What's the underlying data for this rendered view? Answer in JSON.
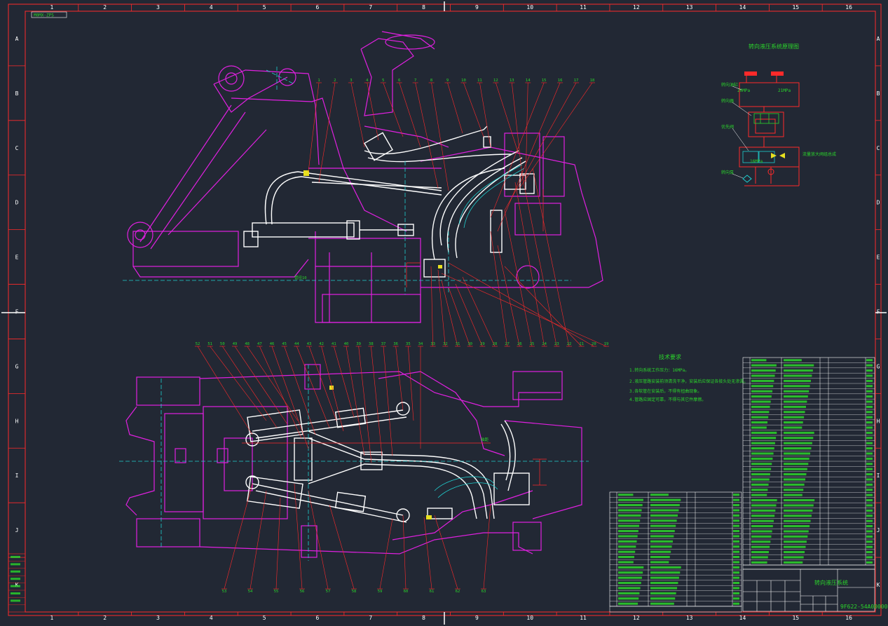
{
  "sheet": {
    "top_tag": "M0MX-ZPS",
    "col_labels": [
      "1",
      "2",
      "3",
      "4",
      "5",
      "6",
      "7",
      "8",
      "9",
      "10",
      "11",
      "12",
      "13",
      "14",
      "15",
      "16"
    ],
    "row_labels": [
      "A",
      "B",
      "C",
      "D",
      "E",
      "F",
      "G",
      "H",
      "I",
      "J",
      "K"
    ],
    "drawing_number": "9F622-54A00000",
    "title_block_name": "转向液压系统"
  },
  "schematic": {
    "title": "转向液压系统原理图",
    "labels": [
      "转向油缸",
      "转向器",
      "优先阀",
      "转向泵",
      "流量放大阀组总成"
    ],
    "pressure_labels": [
      "20MPa",
      "21MPa",
      "16MPa"
    ]
  },
  "tech_notes": {
    "title": "技术要求",
    "lines": [
      "1.转向系统工作压力：16MPa。",
      "2.液压管路安装前须清洗干净，安装后应保证各接头处无渗漏。",
      "3.各软管在安装后，不得有扭曲现象。",
      "4.管路应固定可靠，不得与其它件摩擦。"
    ]
  },
  "balloons_top": [
    "1",
    "2",
    "3",
    "4",
    "5",
    "6",
    "7",
    "8",
    "9",
    "10",
    "11",
    "12",
    "13",
    "14",
    "15",
    "16",
    "17",
    "18"
  ],
  "balloons_mid": [
    "52",
    "51",
    "50",
    "49",
    "48",
    "47",
    "46",
    "45",
    "44",
    "43",
    "42",
    "41",
    "40",
    "39",
    "38",
    "37",
    "36",
    "35",
    "34",
    "33",
    "32",
    "31",
    "30",
    "29",
    "28",
    "27",
    "26",
    "25",
    "24",
    "23",
    "22",
    "21",
    "20",
    "19"
  ],
  "balloons_bottom": [
    "53",
    "54",
    "55",
    "56",
    "57",
    "58",
    "59",
    "60",
    "61",
    "62",
    "63"
  ],
  "dimensions": {
    "top_pipe_label": "管径10",
    "bottom_axis_label": "轴距"
  },
  "colors": {
    "background": "#222834",
    "frame": "#ff2a2a",
    "magenta": "#e020e0",
    "white": "#ffffff",
    "cyan": "#20d0d0",
    "green": "#2bd62b",
    "yellow": "#e8e020"
  }
}
